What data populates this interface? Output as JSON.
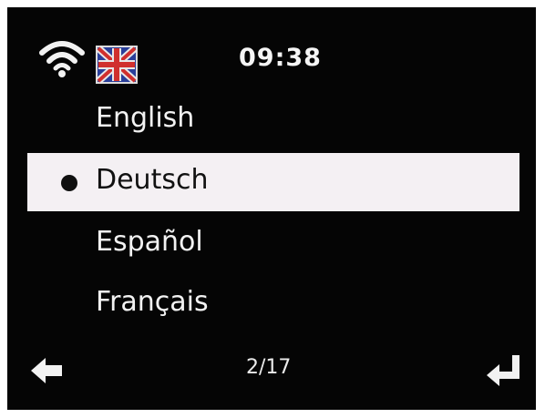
{
  "status_bar": {
    "time": "09:38",
    "wifi_icon": "wifi-signal-icon",
    "flag_icon": "language-flag-icon"
  },
  "menu": {
    "items": [
      {
        "label": "English",
        "selected": false
      },
      {
        "label": "Deutsch",
        "selected": true
      },
      {
        "label": "Español",
        "selected": false
      },
      {
        "label": "Français",
        "selected": false
      }
    ]
  },
  "footer": {
    "page_counter": "2/17",
    "back_icon": "back-arrow-icon",
    "enter_icon": "enter-return-icon"
  },
  "colors": {
    "screen_bg": "#050505",
    "text": "#f2f2f2",
    "highlight_bg": "#f4f0f3",
    "highlight_text": "#111111"
  }
}
